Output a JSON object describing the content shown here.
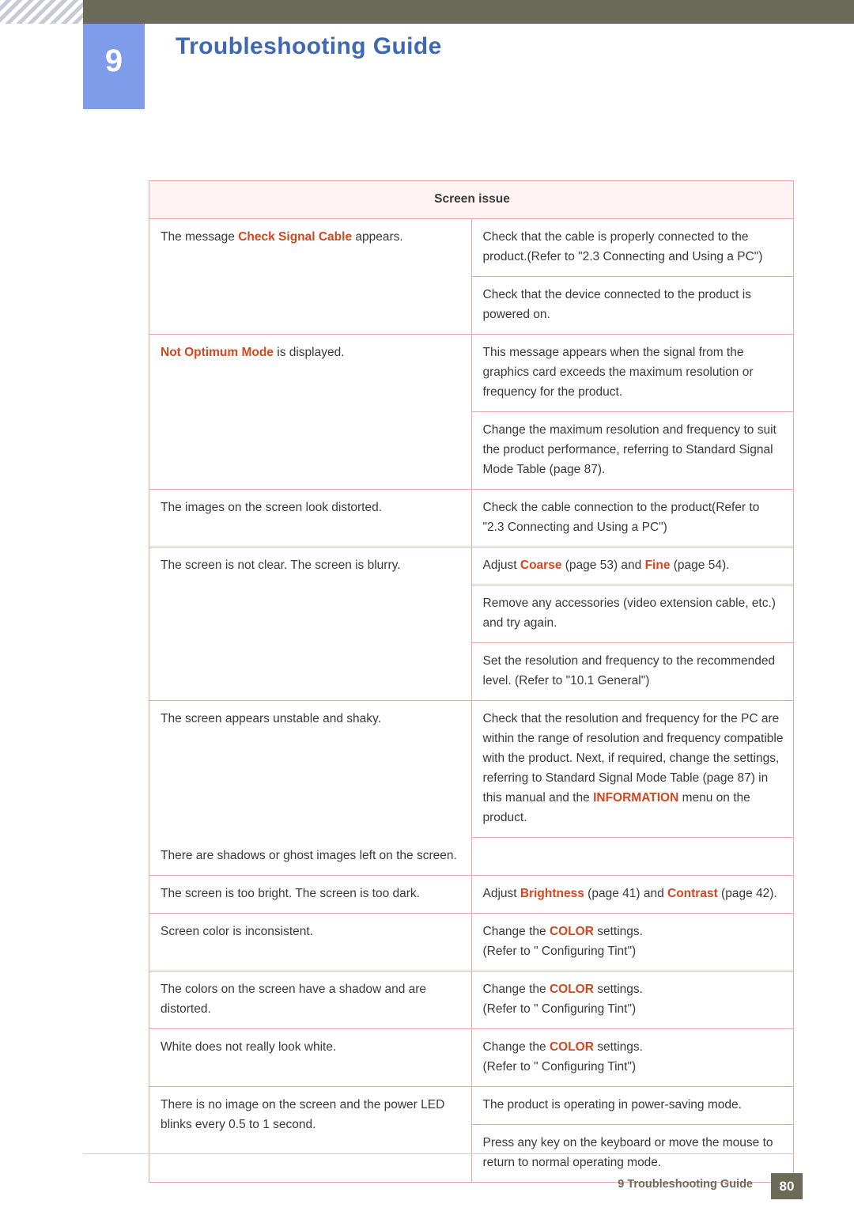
{
  "header": {
    "chapter_number": "9",
    "title": "Troubleshooting Guide"
  },
  "table": {
    "section_title": "Screen issue",
    "rows": [
      {
        "left_parts": [
          {
            "t": "The message ",
            "s": "plain"
          },
          {
            "t": "Check Signal Cable",
            "s": "hl"
          },
          {
            "t": " appears.",
            "s": "plain"
          }
        ],
        "right_cells": [
          [
            {
              "t": "Check that the cable is properly connected to the product.",
              "s": "plain"
            },
            {
              "t": "(Refer to \"2.3 Connecting and Using a PC\")",
              "s": "plain"
            }
          ],
          [
            {
              "t": "Check that the device connected to the product is powered on.",
              "s": "plain"
            }
          ]
        ]
      },
      {
        "left_parts": [
          {
            "t": "Not Optimum Mode",
            "s": "hl"
          },
          {
            "t": " is displayed.",
            "s": "plain"
          }
        ],
        "right_cells": [
          [
            {
              "t": "This message appears when the signal from the graphics card exceeds the maximum resolution or frequency for the product.",
              "s": "plain"
            }
          ],
          [
            {
              "t": "Change the maximum resolution and frequency to suit the product performance, referring to Standard Signal Mode Table (page 87).",
              "s": "plain"
            }
          ]
        ]
      },
      {
        "left_parts": [
          {
            "t": "The images on the screen look distorted.",
            "s": "plain"
          }
        ],
        "right_cells": [
          [
            {
              "t": "Check the cable connection to the product",
              "s": "plain"
            },
            {
              "t": "(Refer to \"2.3 Connecting and Using a PC\")",
              "s": "plain"
            }
          ]
        ]
      },
      {
        "left_parts": [
          {
            "t": "The screen is not clear. The screen is blurry.",
            "s": "plain"
          }
        ],
        "right_cells": [
          [
            {
              "t": "Adjust ",
              "s": "plain"
            },
            {
              "t": "Coarse",
              "s": "hl"
            },
            {
              "t": " (page 53) and ",
              "s": "plain"
            },
            {
              "t": "Fine",
              "s": "hl"
            },
            {
              "t": " (page 54).",
              "s": "plain"
            }
          ],
          [
            {
              "t": "Remove any accessories (video extension cable, etc.) and try again.",
              "s": "plain"
            }
          ],
          [
            {
              "t": "Set the resolution and frequency to the recommended level. (Refer to \"10.1 General\")",
              "s": "plain"
            }
          ]
        ]
      },
      {
        "left_parts": [
          {
            "t": "The screen appears unstable and shaky.",
            "s": "plain"
          }
        ],
        "left_parts_2": [
          {
            "t": "There are shadows or ghost images left on the screen.",
            "s": "plain"
          }
        ],
        "right_cells": [
          [
            {
              "t": "Check that the resolution and frequency for the PC are within the range of resolution and frequency compatible with the product. Next, if required, change the settings, referring to Standard Signal Mode Table (page 87) in this manual and the ",
              "s": "plain"
            },
            {
              "t": "INFORMATION",
              "s": "hl"
            },
            {
              "t": " menu on the product.",
              "s": "plain"
            }
          ]
        ]
      },
      {
        "left_parts": [
          {
            "t": "The screen is too bright. The screen is too dark.",
            "s": "plain"
          }
        ],
        "right_cells": [
          [
            {
              "t": "Adjust ",
              "s": "plain"
            },
            {
              "t": "Brightness",
              "s": "hl"
            },
            {
              "t": " (page 41) and ",
              "s": "plain"
            },
            {
              "t": "Contrast",
              "s": "hl"
            },
            {
              "t": " (page 42).",
              "s": "plain"
            }
          ]
        ]
      },
      {
        "left_parts": [
          {
            "t": "Screen color is inconsistent.",
            "s": "plain"
          }
        ],
        "right_cells": [
          [
            {
              "t": "Change the ",
              "s": "plain"
            },
            {
              "t": "COLOR",
              "s": "hl"
            },
            {
              "t": " settings.",
              "s": "plain"
            },
            {
              "t": "\n(Refer to \" Configuring Tint\")",
              "s": "plain"
            }
          ]
        ]
      },
      {
        "left_parts": [
          {
            "t": "The colors on the screen have a shadow and are distorted.",
            "s": "plain"
          }
        ],
        "right_cells": [
          [
            {
              "t": "Change the ",
              "s": "plain"
            },
            {
              "t": "COLOR",
              "s": "hl"
            },
            {
              "t": " settings.",
              "s": "plain"
            },
            {
              "t": "\n(Refer to \" Configuring Tint\")",
              "s": "plain"
            }
          ]
        ]
      },
      {
        "left_parts": [
          {
            "t": "White does not really look white.",
            "s": "plain"
          }
        ],
        "right_cells": [
          [
            {
              "t": "Change the ",
              "s": "plain"
            },
            {
              "t": "COLOR",
              "s": "hl"
            },
            {
              "t": " settings.",
              "s": "plain"
            },
            {
              "t": "\n(Refer to \" Configuring Tint\")",
              "s": "plain"
            }
          ]
        ]
      },
      {
        "left_parts": [
          {
            "t": "There is no image on the screen and the power LED blinks every 0.5 to 1 second.",
            "s": "plain"
          }
        ],
        "right_cells": [
          [
            {
              "t": "The product is operating in power-saving mode.",
              "s": "plain"
            }
          ],
          [
            {
              "t": "Press any key on the keyboard or move the mouse to return to normal operating mode.",
              "s": "plain"
            }
          ]
        ]
      }
    ]
  },
  "footer": {
    "label": "9 Troubleshooting Guide",
    "page_number": "80"
  },
  "colors": {
    "header_bar": "#6b6a58",
    "badge": "#7f9ceb",
    "title": "#3f68b3",
    "border": "#e3a9a3",
    "section_bg": "#fdf3f3",
    "highlight": "#d2481e"
  }
}
